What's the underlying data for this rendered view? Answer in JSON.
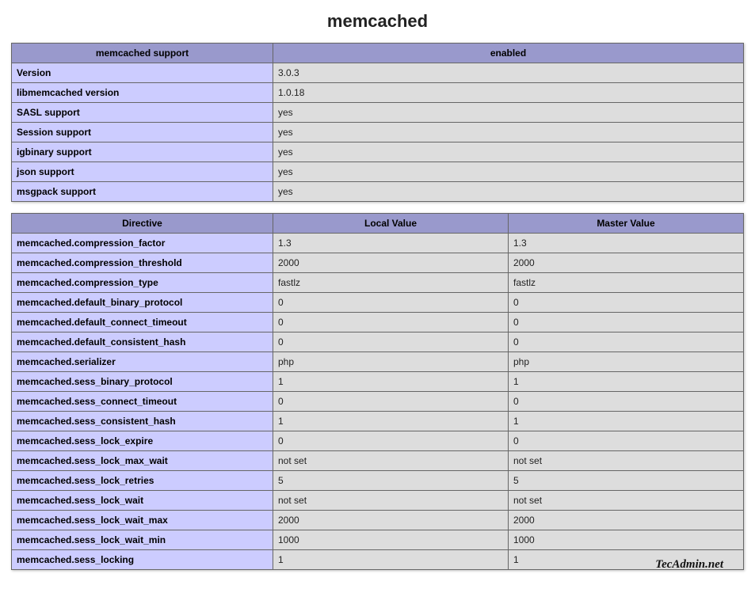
{
  "title": "memcached",
  "support_table": {
    "header_left": "memcached support",
    "header_right": "enabled",
    "rows": [
      {
        "k": "Version",
        "v": "3.0.3"
      },
      {
        "k": "libmemcached version",
        "v": "1.0.18"
      },
      {
        "k": "SASL support",
        "v": "yes"
      },
      {
        "k": "Session support",
        "v": "yes"
      },
      {
        "k": "igbinary support",
        "v": "yes"
      },
      {
        "k": "json support",
        "v": "yes"
      },
      {
        "k": "msgpack support",
        "v": "yes"
      }
    ]
  },
  "directive_table": {
    "header_directive": "Directive",
    "header_local": "Local Value",
    "header_master": "Master Value",
    "rows": [
      {
        "d": "memcached.compression_factor",
        "l": "1.3",
        "m": "1.3"
      },
      {
        "d": "memcached.compression_threshold",
        "l": "2000",
        "m": "2000"
      },
      {
        "d": "memcached.compression_type",
        "l": "fastlz",
        "m": "fastlz"
      },
      {
        "d": "memcached.default_binary_protocol",
        "l": "0",
        "m": "0"
      },
      {
        "d": "memcached.default_connect_timeout",
        "l": "0",
        "m": "0"
      },
      {
        "d": "memcached.default_consistent_hash",
        "l": "0",
        "m": "0"
      },
      {
        "d": "memcached.serializer",
        "l": "php",
        "m": "php"
      },
      {
        "d": "memcached.sess_binary_protocol",
        "l": "1",
        "m": "1"
      },
      {
        "d": "memcached.sess_connect_timeout",
        "l": "0",
        "m": "0"
      },
      {
        "d": "memcached.sess_consistent_hash",
        "l": "1",
        "m": "1"
      },
      {
        "d": "memcached.sess_lock_expire",
        "l": "0",
        "m": "0"
      },
      {
        "d": "memcached.sess_lock_max_wait",
        "l": "not set",
        "m": "not set"
      },
      {
        "d": "memcached.sess_lock_retries",
        "l": "5",
        "m": "5"
      },
      {
        "d": "memcached.sess_lock_wait",
        "l": "not set",
        "m": "not set"
      },
      {
        "d": "memcached.sess_lock_wait_max",
        "l": "2000",
        "m": "2000"
      },
      {
        "d": "memcached.sess_lock_wait_min",
        "l": "1000",
        "m": "1000"
      },
      {
        "d": "memcached.sess_locking",
        "l": "1",
        "m": "1"
      }
    ]
  },
  "watermark": "TecAdmin.net"
}
